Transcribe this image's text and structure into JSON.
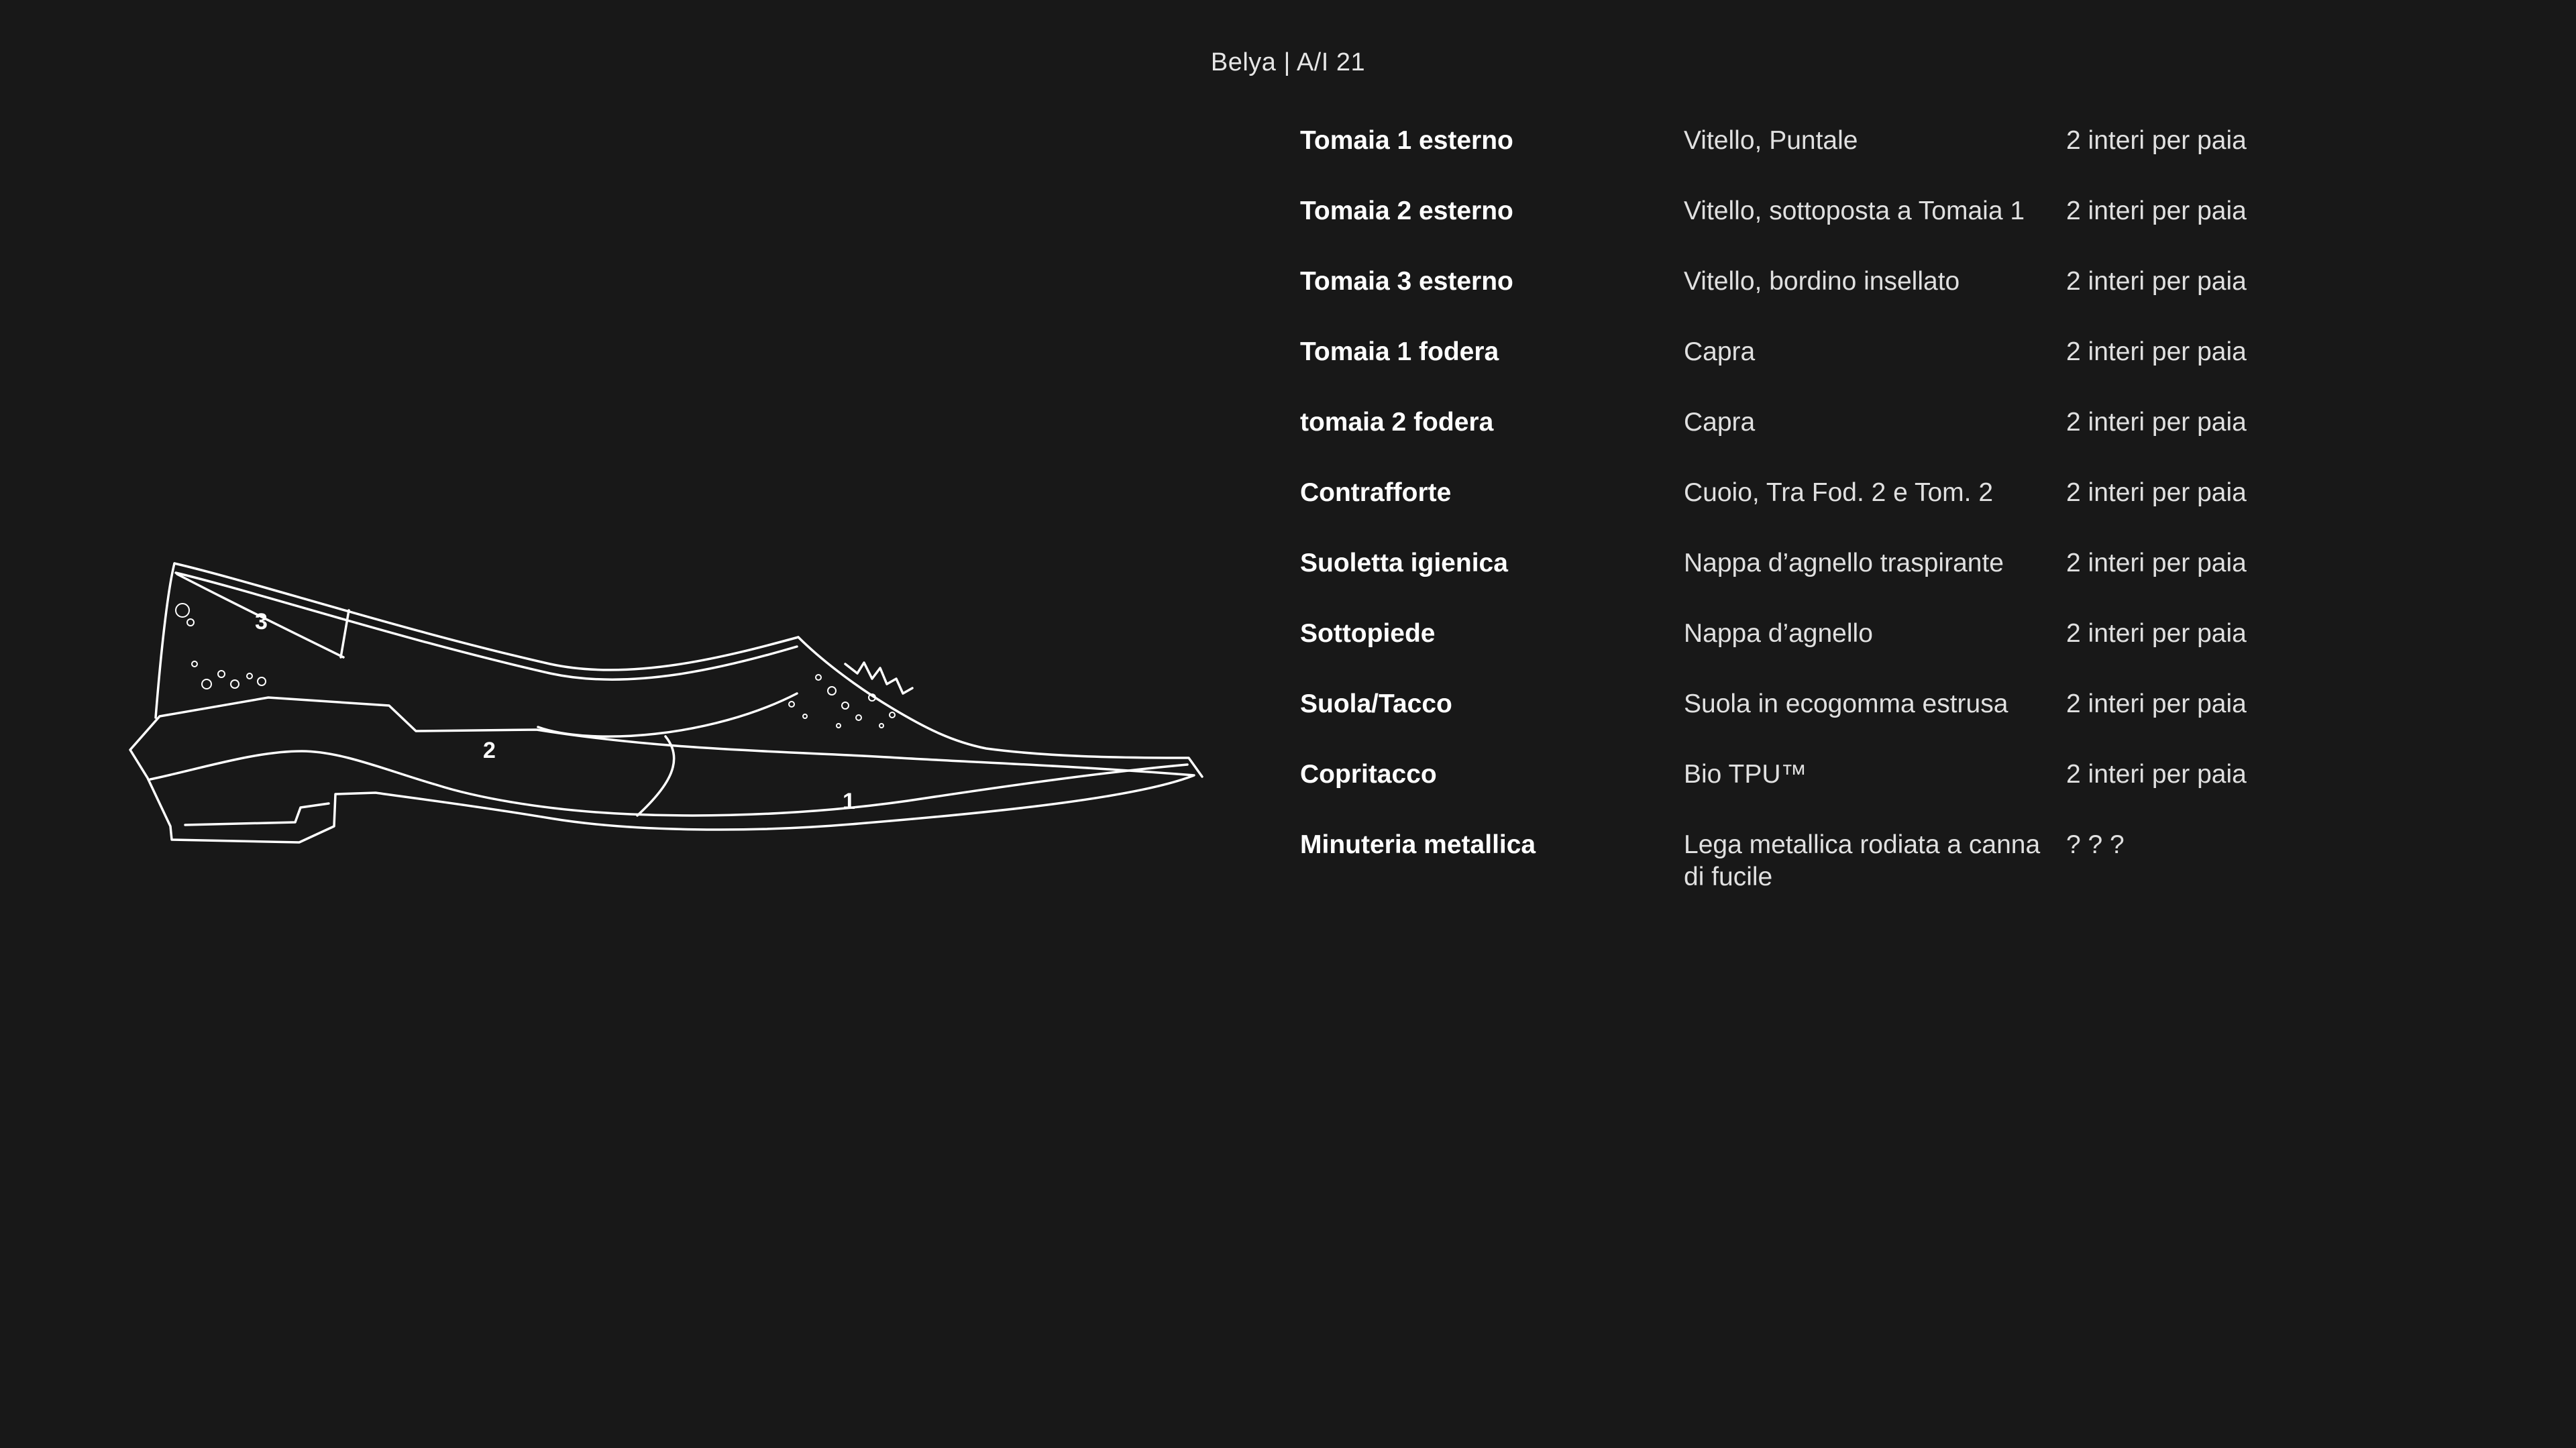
{
  "header": {
    "title": "Belya | A/I 21"
  },
  "illustration": {
    "labels": [
      "1",
      "2",
      "3"
    ],
    "stroke_color": "#ffffff",
    "background": "#181818"
  },
  "spec_table": {
    "rows": [
      {
        "part": "Tomaia 1 esterno",
        "material": "Vitello, Puntale",
        "quantity": "2 interi per paia"
      },
      {
        "part": "Tomaia 2 esterno",
        "material": "Vitello, sottoposta a Tomaia 1",
        "quantity": "2 interi per paia"
      },
      {
        "part": "Tomaia 3 esterno",
        "material": "Vitello, bordino insellato",
        "quantity": "2 interi per paia"
      },
      {
        "part": "Tomaia 1 fodera",
        "material": "Capra",
        "quantity": "2 interi per paia"
      },
      {
        "part": "tomaia 2 fodera",
        "material": "Capra",
        "quantity": "2 interi per paia"
      },
      {
        "part": "Contrafforte",
        "material": "Cuoio, Tra Fod. 2 e Tom. 2",
        "quantity": "2 interi per paia"
      },
      {
        "part": "Suoletta igienica",
        "material": "Nappa d’agnello traspirante",
        "quantity": "2 interi per paia"
      },
      {
        "part": "Sottopiede",
        "material": "Nappa d’agnello",
        "quantity": "2 interi per paia"
      },
      {
        "part": "Suola/Tacco",
        "material": "Suola in ecogomma estrusa",
        "quantity": "2 interi per paia"
      },
      {
        "part": "Copritacco",
        "material": "Bio TPU™",
        "quantity": "2 interi per paia"
      },
      {
        "part": "Minuteria metallica",
        "material": "Lega metallica rodiata a canna di fucile",
        "quantity": "? ? ?"
      }
    ]
  }
}
